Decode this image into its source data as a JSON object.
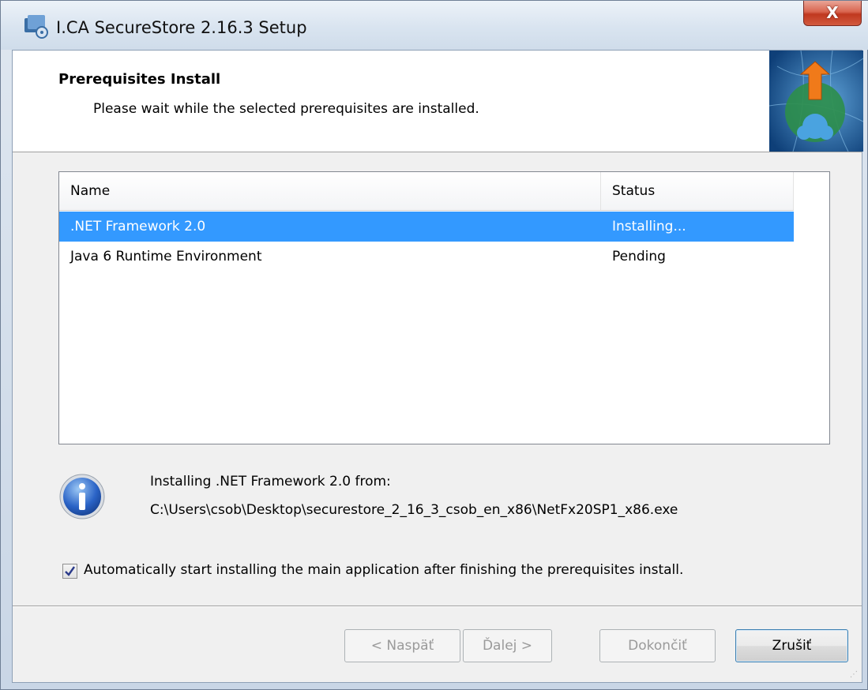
{
  "window": {
    "title": "I.CA SecureStore 2.16.3 Setup",
    "close_glyph": "X"
  },
  "header": {
    "title": "Prerequisites Install",
    "subtitle": "Please wait while the selected prerequisites are installed."
  },
  "list": {
    "columns": {
      "name": "Name",
      "status": "Status"
    },
    "rows": [
      {
        "name": ".NET Framework 2.0",
        "status": "Installing...",
        "selected": true
      },
      {
        "name": "Java 6 Runtime Environment",
        "status": "Pending",
        "selected": false
      }
    ]
  },
  "info": {
    "line1": "Installing .NET Framework 2.0 from:",
    "line2": "C:\\Users\\csob\\Desktop\\securestore_2_16_3_csob_en_x86\\NetFx20SP1_x86.exe"
  },
  "auto_start": {
    "checked": true,
    "label": "Automatically start installing the main application after finishing the prerequisites install."
  },
  "buttons": {
    "back": "< Naspäť",
    "next": "Ďalej >",
    "finish": "Dokončiť",
    "cancel": "Zrušiť"
  },
  "colors": {
    "selection": "#3399ff",
    "close_button": "#c0381f"
  }
}
